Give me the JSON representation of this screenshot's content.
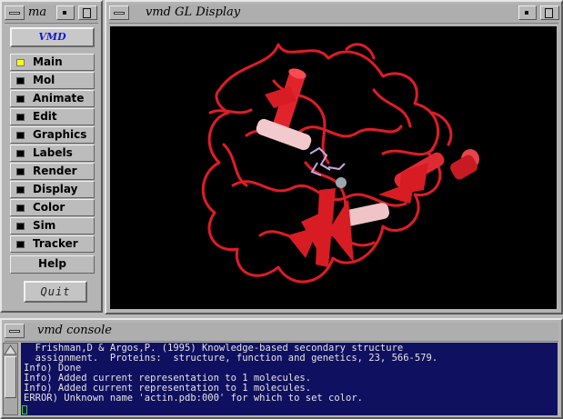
{
  "menu_window": {
    "title": "ma",
    "vmd_button": "VMD",
    "items": [
      {
        "label": "Main",
        "active": true
      },
      {
        "label": "Mol",
        "active": false
      },
      {
        "label": "Animate",
        "active": false
      },
      {
        "label": "Edit",
        "active": false
      },
      {
        "label": "Graphics",
        "active": false
      },
      {
        "label": "Labels",
        "active": false
      },
      {
        "label": "Render",
        "active": false
      },
      {
        "label": "Display",
        "active": false
      },
      {
        "label": "Color",
        "active": false
      },
      {
        "label": "Sim",
        "active": false
      },
      {
        "label": "Tracker",
        "active": false
      }
    ],
    "help_label": "Help",
    "quit_label": "Quit",
    "active_indicator_color": "#ffff00"
  },
  "gl_window": {
    "title": "vmd GL Display",
    "background": "#000000",
    "molecule_color": "#e8202a"
  },
  "console_window": {
    "title": "vmd console",
    "background": "#101060",
    "lines": [
      "  Frishman,D & Argos,P. (1995) Knowledge-based secondary structure",
      "  assignment.  Proteins:  structure, function and genetics, 23, 566-579.",
      "Info) Done",
      "Info) Added current representation to 1 molecules.",
      "Info) Added current representation to 1 molecules.",
      "ERROR) Unknown name 'actin.pdb:000' for which to set color."
    ]
  }
}
